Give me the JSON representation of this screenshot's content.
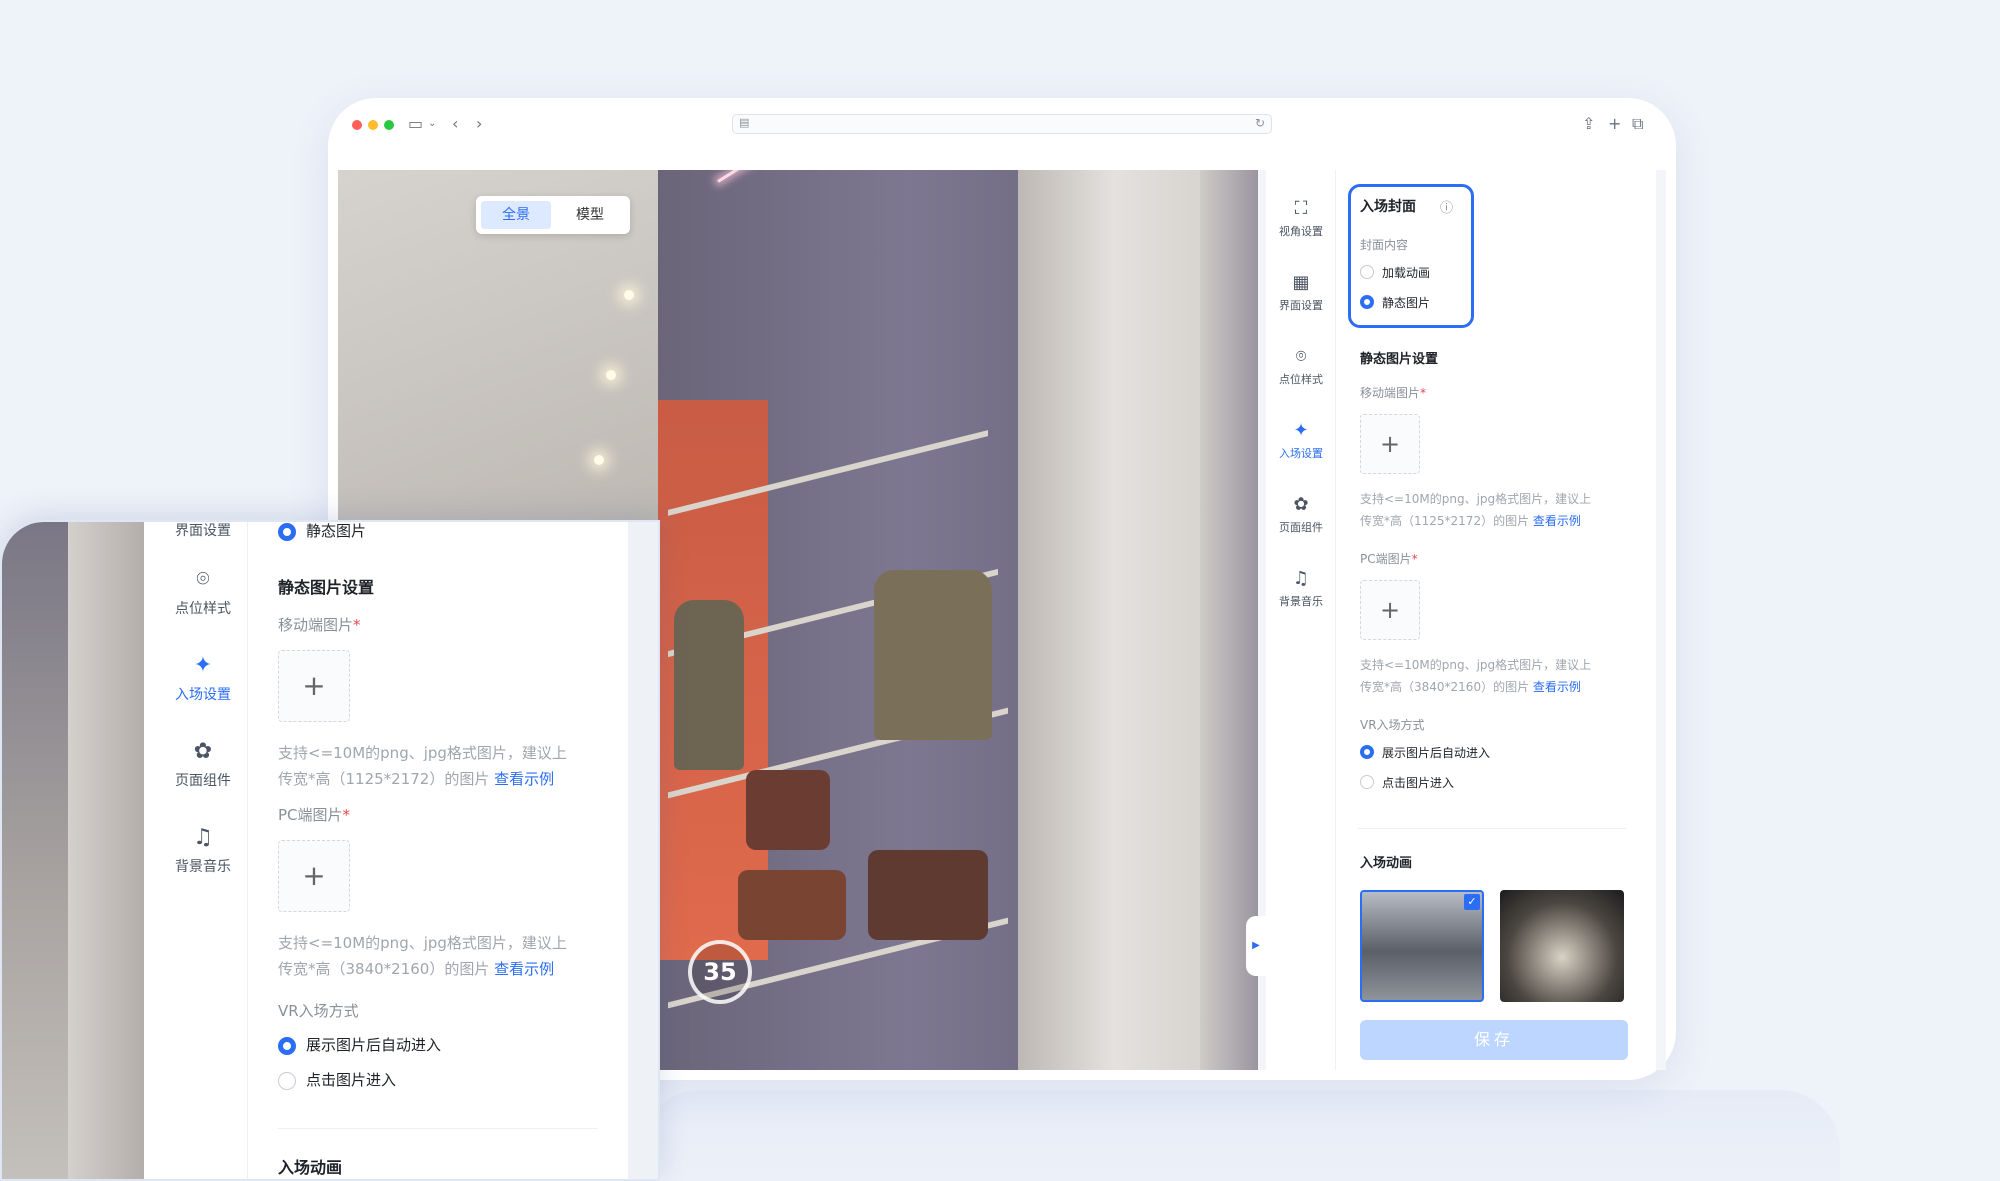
{
  "browser": {
    "url_left_icon": "page-icon",
    "url_reload_icon": "reload-icon",
    "controls": [
      "sidebar-icon",
      "chevron-down-icon",
      "back-icon",
      "forward-icon",
      "share-icon",
      "plus-icon",
      "tabs-icon"
    ]
  },
  "viewer": {
    "tabs": {
      "panorama": "全景",
      "model": "模型"
    },
    "badge": "35"
  },
  "sidenav": {
    "items": [
      {
        "label": "视角设置",
        "icon": "view-angle-icon"
      },
      {
        "label": "界面设置",
        "icon": "interface-icon"
      },
      {
        "label": "点位样式",
        "icon": "location-pin-icon"
      },
      {
        "label": "入场设置",
        "icon": "sparkle-icon",
        "active": true
      },
      {
        "label": "页面组件",
        "icon": "puzzle-icon"
      },
      {
        "label": "背景音乐",
        "icon": "music-note-icon"
      }
    ]
  },
  "panel": {
    "cover_title": "入场封面",
    "cover_content_label": "封面内容",
    "cover_options": [
      "加载动画",
      "静态图片"
    ],
    "cover_selected": 1,
    "static_title": "静态图片设置",
    "mobile_label": "移动端图片",
    "mobile_help": "支持<=10M的png、jpg格式图片，建议上",
    "mobile_help2": "传宽*高（1125*2172）的图片",
    "pc_label": "PC端图片",
    "pc_help": "支持<=10M的png、jpg格式图片，建议上",
    "pc_help2": "传宽*高（3840*2160）的图片",
    "example_link": "查看示例",
    "required_mark": "*",
    "upload_plus": "+",
    "vr_label": "VR入场方式",
    "vr_options": [
      "展示图片后自动进入",
      "点击图片进入"
    ],
    "vr_selected": 0,
    "anim_title": "入场动画",
    "save": "保存"
  },
  "colors": {
    "accent": "#2b6ef5",
    "save_disabled": "#bcd6ff"
  }
}
